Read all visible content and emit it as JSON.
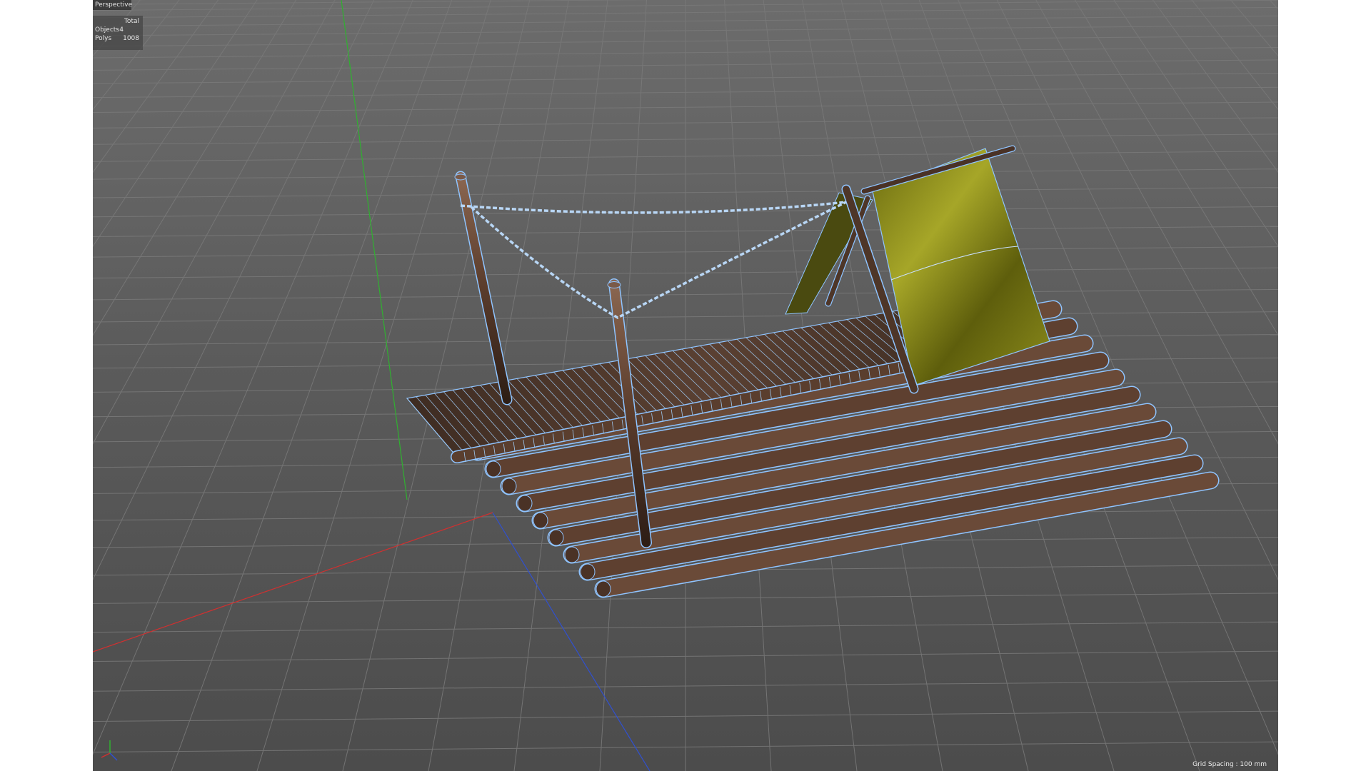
{
  "viewport": {
    "view_name": "Perspective",
    "stats": {
      "column_header": "Total",
      "rows": [
        {
          "label": "Objects",
          "value": "4"
        },
        {
          "label": "Polys",
          "value": "1008"
        }
      ]
    },
    "grid_spacing": "Grid Spacing : 100 mm"
  },
  "colors": {
    "viewport_background": "#5a5a5a",
    "grid_line": "#7a7a7a",
    "axis_x": "#d03030",
    "axis_y": "#30b030",
    "axis_z": "#3050d0",
    "wireframe_highlight": "#8fc4ff",
    "wood": "#6a4a38",
    "cloth": "#8a8a18"
  },
  "icons": [
    "axis-gizmo-icon"
  ]
}
